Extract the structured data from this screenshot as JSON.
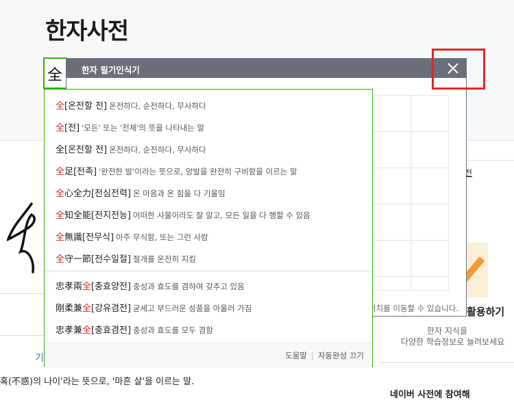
{
  "page": {
    "title": "한자사전"
  },
  "search": {
    "value": "全"
  },
  "handwriting": {
    "title": "한자 필기인식기",
    "note": "위치를 이동할 수 있습니다."
  },
  "autocomplete": {
    "items": [
      {
        "pre": "",
        "hl": "全",
        "post": "",
        "reading": "[온전할 전]",
        "meaning": "온전하다, 순전하다, 무사하다"
      },
      {
        "pre": "",
        "hl": "全",
        "post": "",
        "reading": "[전]",
        "meaning": "'모든' 또는 '전체'의 뜻을 나타내는 말"
      },
      {
        "pre": "",
        "hl": "",
        "post": "全",
        "reading": "[온전할 전]",
        "meaning": "온전하다, 순전하다, 무사하다"
      },
      {
        "pre": "",
        "hl": "全",
        "post": "足",
        "reading": "[전족]",
        "meaning": "'완전한 발'이라는 뜻으로, 양발을 완전히 구비함을 이르는 말"
      },
      {
        "pre": "",
        "hl": "全",
        "post": "心全力",
        "reading": "[전심전력]",
        "meaning": "온 마음과 온 힘을 다 기울임"
      },
      {
        "pre": "",
        "hl": "全",
        "post": "知全能",
        "reading": "[전지전능]",
        "meaning": "어떠한 사물이라도 잘 알고, 모든 일을 다 행할 수 있음"
      },
      {
        "pre": "",
        "hl": "全",
        "post": "無識",
        "reading": "[전무식]",
        "meaning": "아주 무식함, 또는 그런 사람"
      },
      {
        "pre": "",
        "hl": "全",
        "post": "守一節",
        "reading": "[전수일절]",
        "meaning": "절개를 온전히 지킴"
      },
      {
        "pre": "忠孝兩",
        "hl": "全",
        "post": "",
        "reading": "[충효양전]",
        "meaning": "충성과 효도를 겸하여 갖추고 있음"
      },
      {
        "pre": "剛柔兼",
        "hl": "全",
        "post": "",
        "reading": "[강유겸전]",
        "meaning": "굳세고 부드러운 성품을 아울러 가짐"
      },
      {
        "pre": "忠孝兼",
        "hl": "全",
        "post": "",
        "reading": "[충효겸전]",
        "meaning": "충성과 효도를 모두 겸함"
      }
    ],
    "footer": {
      "help": "도움말",
      "autocomplete_off": "자동완성 끄기"
    }
  },
  "right_column": {
    "link_fragment": "전",
    "promo_title": "활용하기",
    "promo_desc1": "한자 지식을",
    "promo_desc2": "다양한 학습정보로 늘려보세요",
    "bottom_fragment": "네이버 사전에 참여해"
  },
  "left_column": {
    "small_icon_text": "기"
  },
  "bottom": {
    "text": "혹(不惑)의 나이'라는 뜻으로, '마흔 살'을 이르는 말."
  }
}
